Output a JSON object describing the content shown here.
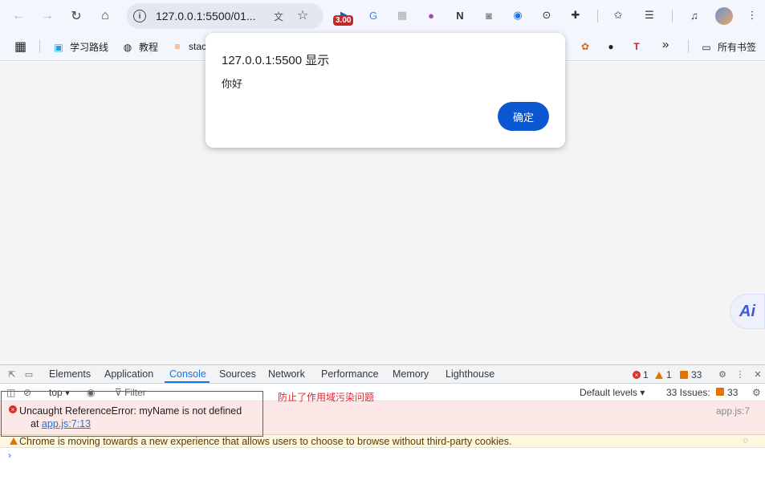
{
  "toolbar": {
    "url": "127.0.0.1:5500/01...",
    "ext_badge": "3.00"
  },
  "bookmarks": {
    "items": [
      {
        "label": "学习路线"
      },
      {
        "label": "教程"
      },
      {
        "label": "stac"
      }
    ],
    "all_bookmarks": "所有书签",
    "overflow": "»"
  },
  "dialog": {
    "title": "127.0.0.1:5500 显示",
    "message": "你好",
    "ok_label": "确定"
  },
  "ai_button": "Ai",
  "devtools": {
    "tabs": [
      "Elements",
      "Application",
      "Console",
      "Sources",
      "Network",
      "Performance",
      "Memory",
      "Lighthouse"
    ],
    "active_tab": "Console",
    "counts": {
      "errors": "1",
      "warnings": "1",
      "issues": "33"
    },
    "filterbar": {
      "context": "top",
      "filter_placeholder": "Filter",
      "levels": "Default levels",
      "issues_label": "33 Issues:",
      "issues_count": "33"
    },
    "error": {
      "message": "Uncaught ReferenceError: myName is not defined",
      "at_prefix": "at",
      "link": "app.js:7:13",
      "source": "app.js:7"
    },
    "warning": {
      "message": "Chrome is moving towards a new experience that allows users to choose to browse without third-party cookies."
    },
    "prompt": "›"
  },
  "annotation": {
    "text": "防止了作用域污染问题",
    "color": "#e0252b"
  },
  "colors": {
    "accent": "#1a73e8",
    "dialog_button": "#0b57d0",
    "error_bg": "#fce8e6",
    "warning_bg": "#fef7e0"
  }
}
